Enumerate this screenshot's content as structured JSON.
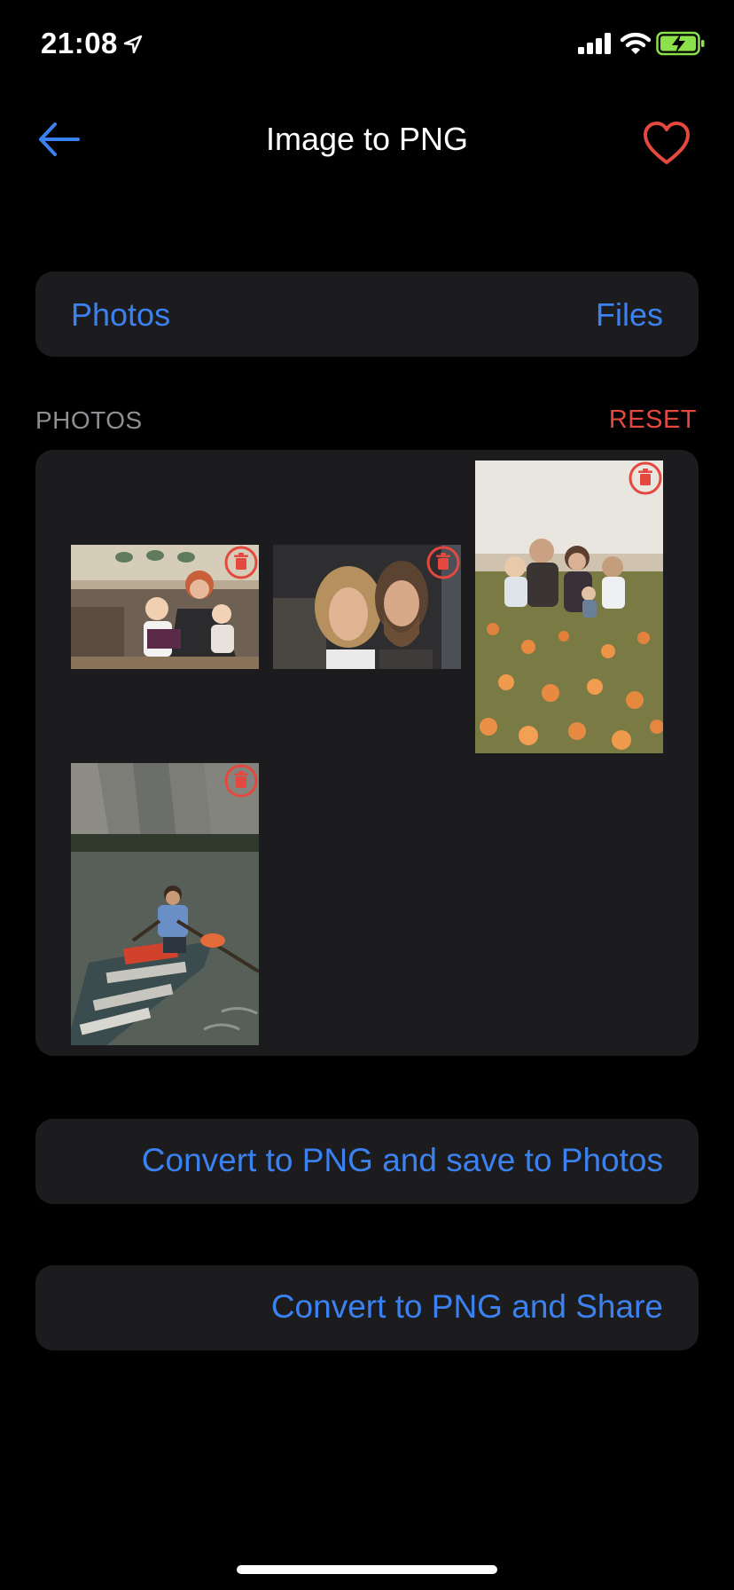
{
  "status_bar": {
    "time": "21:08",
    "icons": [
      "location-arrow-icon",
      "cellular-signal-icon",
      "wifi-icon",
      "battery-charging-icon"
    ]
  },
  "nav": {
    "back_icon": "arrow-left-icon",
    "title": "Image to PNG",
    "favorite_icon": "heart-icon"
  },
  "source": {
    "photos_label": "Photos",
    "files_label": "Files"
  },
  "photos_section": {
    "label": "PHOTOS",
    "reset_label": "RESET",
    "items": [
      {
        "description": "photo",
        "delete_icon": "trash-icon"
      },
      {
        "description": "photo",
        "delete_icon": "trash-icon"
      },
      {
        "description": "photo",
        "delete_icon": "trash-icon"
      },
      {
        "description": "photo",
        "delete_icon": "trash-icon"
      }
    ]
  },
  "actions": {
    "save_label": "Convert to PNG and save to Photos",
    "share_label": "Convert to PNG and Share"
  },
  "colors": {
    "background": "#000000",
    "card": "#1c1c1e",
    "accent_blue": "#3b82f0",
    "accent_red": "#e5483f",
    "secondary_text": "#8e8e93"
  }
}
